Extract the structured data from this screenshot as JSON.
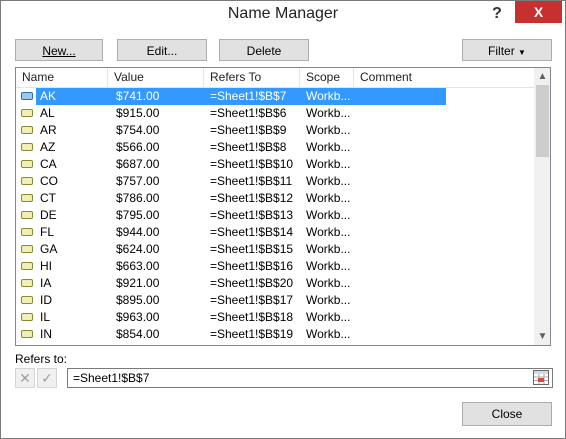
{
  "window": {
    "title": "Name Manager",
    "help": "?",
    "close": "X"
  },
  "toolbar": {
    "new_label": "New...",
    "edit_label": "Edit...",
    "delete_label": "Delete",
    "filter_label": "Filter"
  },
  "columns": [
    "Name",
    "Value",
    "Refers To",
    "Scope",
    "Comment"
  ],
  "rows": [
    {
      "name": "AK",
      "value": "$741.00",
      "refers": "=Sheet1!$B$7",
      "scope": "Workb...",
      "comment": "",
      "selected": true
    },
    {
      "name": "AL",
      "value": "$915.00",
      "refers": "=Sheet1!$B$6",
      "scope": "Workb...",
      "comment": ""
    },
    {
      "name": "AR",
      "value": "$754.00",
      "refers": "=Sheet1!$B$9",
      "scope": "Workb...",
      "comment": ""
    },
    {
      "name": "AZ",
      "value": "$566.00",
      "refers": "=Sheet1!$B$8",
      "scope": "Workb...",
      "comment": ""
    },
    {
      "name": "CA",
      "value": "$687.00",
      "refers": "=Sheet1!$B$10",
      "scope": "Workb...",
      "comment": ""
    },
    {
      "name": "CO",
      "value": "$757.00",
      "refers": "=Sheet1!$B$11",
      "scope": "Workb...",
      "comment": ""
    },
    {
      "name": "CT",
      "value": "$786.00",
      "refers": "=Sheet1!$B$12",
      "scope": "Workb...",
      "comment": ""
    },
    {
      "name": "DE",
      "value": "$795.00",
      "refers": "=Sheet1!$B$13",
      "scope": "Workb...",
      "comment": ""
    },
    {
      "name": "FL",
      "value": "$944.00",
      "refers": "=Sheet1!$B$14",
      "scope": "Workb...",
      "comment": ""
    },
    {
      "name": "GA",
      "value": "$624.00",
      "refers": "=Sheet1!$B$15",
      "scope": "Workb...",
      "comment": ""
    },
    {
      "name": "HI",
      "value": "$663.00",
      "refers": "=Sheet1!$B$16",
      "scope": "Workb...",
      "comment": ""
    },
    {
      "name": "IA",
      "value": "$921.00",
      "refers": "=Sheet1!$B$20",
      "scope": "Workb...",
      "comment": ""
    },
    {
      "name": "ID",
      "value": "$895.00",
      "refers": "=Sheet1!$B$17",
      "scope": "Workb...",
      "comment": ""
    },
    {
      "name": "IL",
      "value": "$963.00",
      "refers": "=Sheet1!$B$18",
      "scope": "Workb...",
      "comment": ""
    },
    {
      "name": "IN",
      "value": "$854.00",
      "refers": "=Sheet1!$B$19",
      "scope": "Workb...",
      "comment": ""
    }
  ],
  "refers_to": {
    "label": "Refers to:",
    "value": "=Sheet1!$B$7"
  },
  "close_label": "Close",
  "icons": {
    "cancel": "x-icon",
    "confirm": "check-icon",
    "collapse": "range-picker-icon",
    "name": "named-range-icon"
  },
  "colors": {
    "selection": "#3399ff",
    "close_red": "#c7302f"
  }
}
